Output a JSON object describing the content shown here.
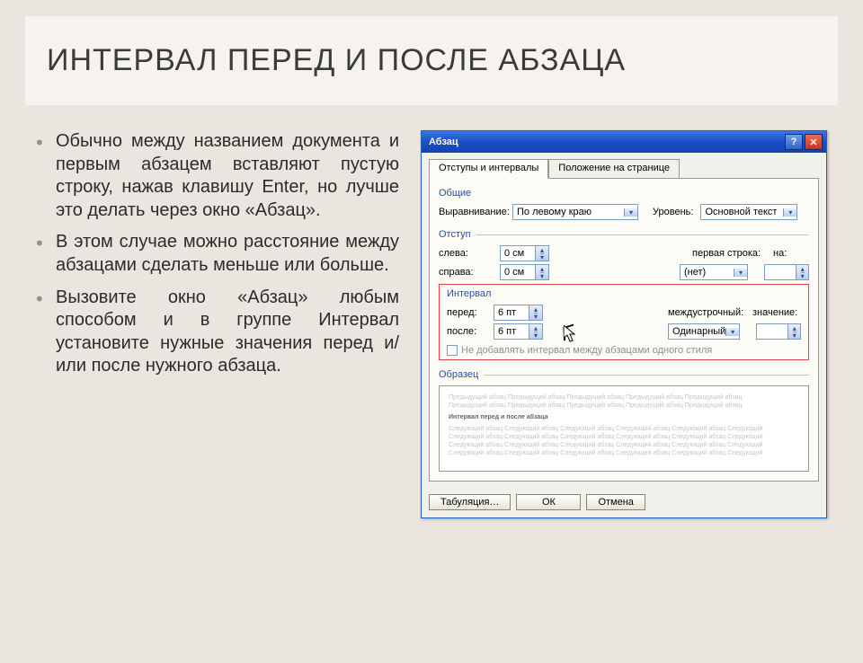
{
  "slide": {
    "title": "ИНТЕРВАЛ ПЕРЕД И ПОСЛЕ АБЗАЦА",
    "bullets": [
      "Обычно между названием документа и первым абзацем вставляют пустую строку, нажав клавишу Enter, но лучше это делать через окно «Абзац».",
      "В этом случае можно расстояние между абзацами сделать меньше или больше.",
      "Вызовите окно «Абзац» любым способом и в группе Интервал установите нужные значения перед и/или после нужного абзаца."
    ]
  },
  "dialog": {
    "title": "Абзац",
    "tabs": [
      "Отступы и интервалы",
      "Положение на странице"
    ],
    "sections": {
      "general": "Общие",
      "indent": "Отступ",
      "interval": "Интервал",
      "preview": "Образец"
    },
    "labels": {
      "alignment": "Выравнивание:",
      "level": "Уровень:",
      "left": "слева:",
      "right": "справа:",
      "firstLine": "первая строка:",
      "by1": "на:",
      "before": "перед:",
      "after": "после:",
      "lineSpacing": "междустрочный:",
      "by2": "значение:",
      "noSpace": "Не добавлять интервал между абзацами одного стиля"
    },
    "values": {
      "alignment": "По левому краю",
      "level": "Основной текст",
      "left": "0 см",
      "right": "0 см",
      "firstLine": "(нет)",
      "by1": "",
      "before": "6 пт",
      "after": "6 пт",
      "lineSpacing": "Одинарный",
      "by2": ""
    },
    "preview": {
      "heading": "Интервал перед и после абзаца"
    },
    "buttons": {
      "tabs": "Табуляция…",
      "ok": "ОК",
      "cancel": "Отмена"
    }
  }
}
